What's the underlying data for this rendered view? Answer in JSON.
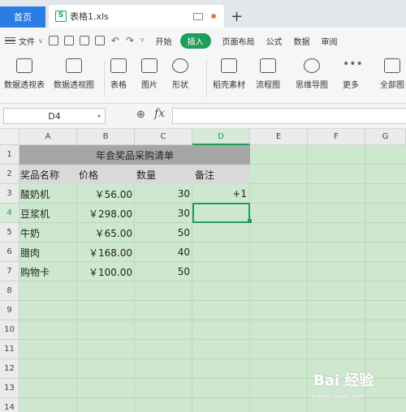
{
  "tabs": {
    "home": "首页",
    "file": "表格1.xls",
    "new_tab": "+"
  },
  "menu": {
    "file": "文件",
    "items": [
      "开始",
      "插入",
      "页面布局",
      "公式",
      "数据",
      "审阅"
    ],
    "active": "插入"
  },
  "ribbon": [
    {
      "label": "数据透视表",
      "icon": "pivot-table-icon"
    },
    {
      "label": "数据透视图",
      "icon": "pivot-chart-icon"
    },
    {
      "label": "表格",
      "icon": "table-icon"
    },
    {
      "label": "图片",
      "icon": "picture-icon"
    },
    {
      "label": "形状",
      "icon": "shape-icon"
    },
    {
      "label": "稻壳素材",
      "icon": "material-icon"
    },
    {
      "label": "流程图",
      "icon": "flowchart-icon"
    },
    {
      "label": "思维导图",
      "icon": "mindmap-icon"
    },
    {
      "label": "更多",
      "icon": "more-icon"
    },
    {
      "label": "全部图",
      "icon": "all-charts-icon"
    }
  ],
  "formula": {
    "cell_ref": "D4",
    "fx": "fx",
    "value": ""
  },
  "columns": [
    "A",
    "B",
    "C",
    "D",
    "E",
    "F",
    "G"
  ],
  "rows": [
    "1",
    "2",
    "3",
    "4",
    "5",
    "6",
    "7",
    "8",
    "9",
    "10",
    "11",
    "12",
    "13",
    "14"
  ],
  "selected": {
    "column": "D",
    "row": "4"
  },
  "sheet": {
    "title": "年会奖品采购清单",
    "headers": [
      "奖品名称",
      "价格",
      "数量",
      "备注"
    ],
    "data": [
      {
        "name": "酸奶机",
        "price": "￥56.00",
        "qty": "30",
        "note": "+1"
      },
      {
        "name": "豆浆机",
        "price": "￥298.00",
        "qty": "30",
        "note": ""
      },
      {
        "name": "牛奶",
        "price": "￥65.00",
        "qty": "50",
        "note": ""
      },
      {
        "name": "腊肉",
        "price": "￥168.00",
        "qty": "40",
        "note": ""
      },
      {
        "name": "购物卡",
        "price": "￥100.00",
        "qty": "50",
        "note": ""
      }
    ]
  },
  "watermark": {
    "brand": "Bai 经验",
    "url": "jingyan.baidu.com"
  }
}
